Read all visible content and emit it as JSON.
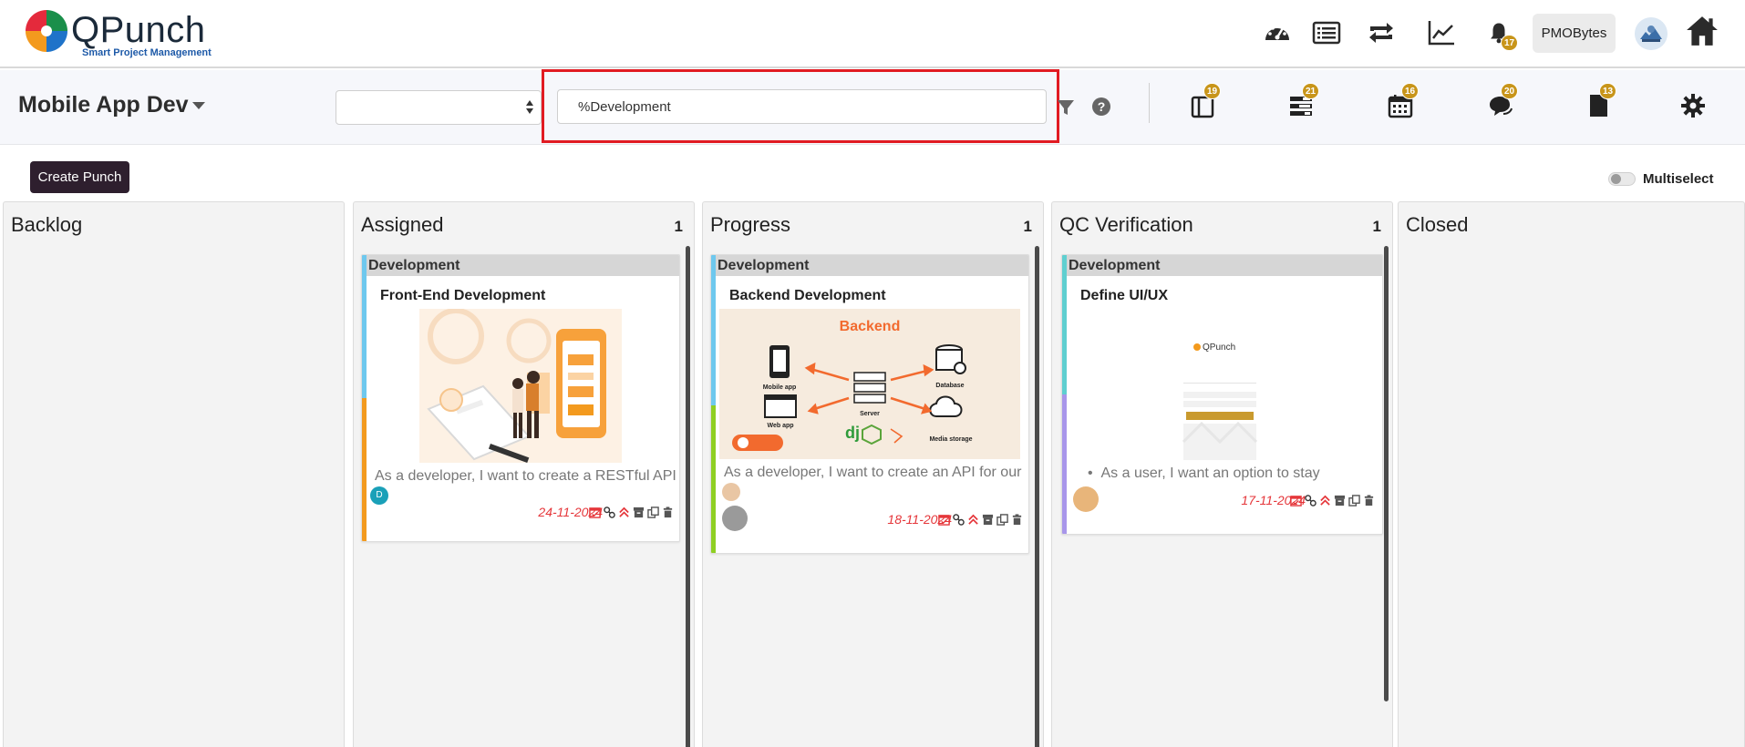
{
  "app": {
    "logo_name": "QPunch",
    "logo_tagline": "Smart Project Management",
    "user_label": "PMOBytes",
    "notification_count": "17",
    "colors": {
      "brand_dark": "#2e1f2e",
      "badge": "#c8951a",
      "highlight": "#e11b22",
      "overdue": "#e5363a"
    }
  },
  "subheader": {
    "project_name": "Mobile App Dev",
    "select_value": "",
    "search_value": "%Development",
    "icons": [
      {
        "name": "punch-list-icon",
        "badge": "19"
      },
      {
        "name": "stack-icon",
        "badge": "21"
      },
      {
        "name": "calendar-icon",
        "badge": "16"
      },
      {
        "name": "chat-icon",
        "badge": "20"
      },
      {
        "name": "document-icon",
        "badge": "13"
      },
      {
        "name": "gear-icon",
        "badge": ""
      }
    ]
  },
  "actions": {
    "create_label": "Create Punch",
    "multiselect_label": "Multiselect"
  },
  "board": {
    "columns": [
      {
        "title": "Backlog",
        "count": ""
      },
      {
        "title": "Assigned",
        "count": "1"
      },
      {
        "title": "Progress",
        "count": "1"
      },
      {
        "title": "QC Verification",
        "count": "1"
      },
      {
        "title": "Closed",
        "count": ""
      }
    ],
    "cards": [
      {
        "category": "Development",
        "title": "Front-End Development",
        "description": "As a developer, I want to create a RESTful API",
        "assignee_initial": "D",
        "due_date": "24-11-2024"
      },
      {
        "category": "Development",
        "title": "Backend Development",
        "description": "As a developer, I want to create an API for our",
        "image_heading": "Backend",
        "image_labels": [
          "Mobile app",
          "Web app",
          "Server",
          "Database",
          "Media storage"
        ],
        "due_date": "18-11-2024"
      },
      {
        "category": "Development",
        "title": "Define UI/UX",
        "description": "As a user, I want an option to stay",
        "image_logo": "QPunch",
        "due_date": "17-11-2024"
      }
    ]
  }
}
